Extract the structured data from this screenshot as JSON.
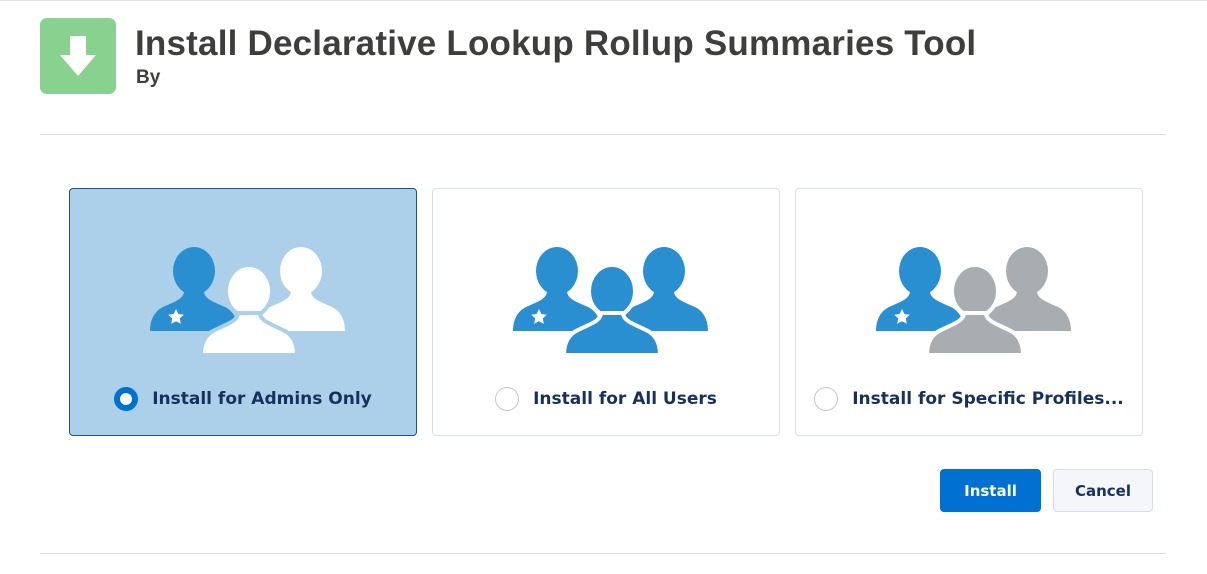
{
  "header": {
    "title": "Install Declarative Lookup Rollup Summaries Tool",
    "byline": "By",
    "icon": "download-arrow-icon"
  },
  "options": [
    {
      "label": "Install for Admins Only",
      "selected": true,
      "icon": "users-admin-icon"
    },
    {
      "label": "Install for All Users",
      "selected": false,
      "icon": "users-all-icon"
    },
    {
      "label": "Install for Specific Profiles...",
      "selected": false,
      "icon": "users-profiles-icon"
    }
  ],
  "buttons": {
    "install": "Install",
    "cancel": "Cancel"
  },
  "colors": {
    "brand": "#0070d2",
    "selected_card": "#acd0ea",
    "icon_green": "#88d18e",
    "person_blue": "#2a8fd1",
    "person_gray": "#a8adb1"
  }
}
